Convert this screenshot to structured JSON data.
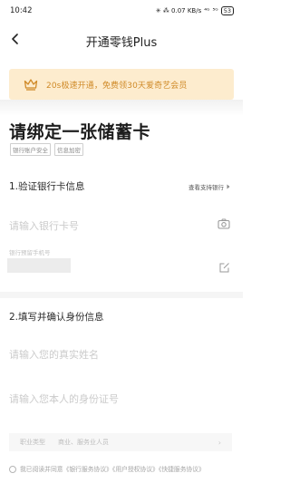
{
  "status_bar": {
    "time": "10:42",
    "icons_text": "✳ ⁂ 0.07 KB/s",
    "network_1": "⁴ᴳ",
    "network_2": "⁵ᴳ",
    "battery": "53"
  },
  "nav": {
    "back_icon": "chevron-left-icon",
    "title": "开通零钱Plus"
  },
  "promo": {
    "icon": "crown-icon",
    "text": "20s极速开通，免费领30天爱奇艺会员",
    "color": "#d08a28",
    "background": "#fdecce"
  },
  "card": {
    "title": "请绑定一张储蓄卡",
    "tags": [
      "银行账户安全",
      "信息加密"
    ]
  },
  "section1": {
    "title": "1.验证银行卡信息",
    "support_link": "查看支持银行",
    "card_number_placeholder": "请输入银行卡号",
    "phone_label": "银行预留手机号"
  },
  "section2": {
    "title": "2.填写并确认身份信息",
    "name_placeholder": "请输入您的真实姓名",
    "id_placeholder": "请输入您本人的身份证号"
  },
  "occupation": {
    "label": "职业类型",
    "value": "商业、服务业人员"
  },
  "agreement": {
    "text": "我已阅读并同意《银行服务协议》《用户授权协议》《快捷服务协议》"
  }
}
